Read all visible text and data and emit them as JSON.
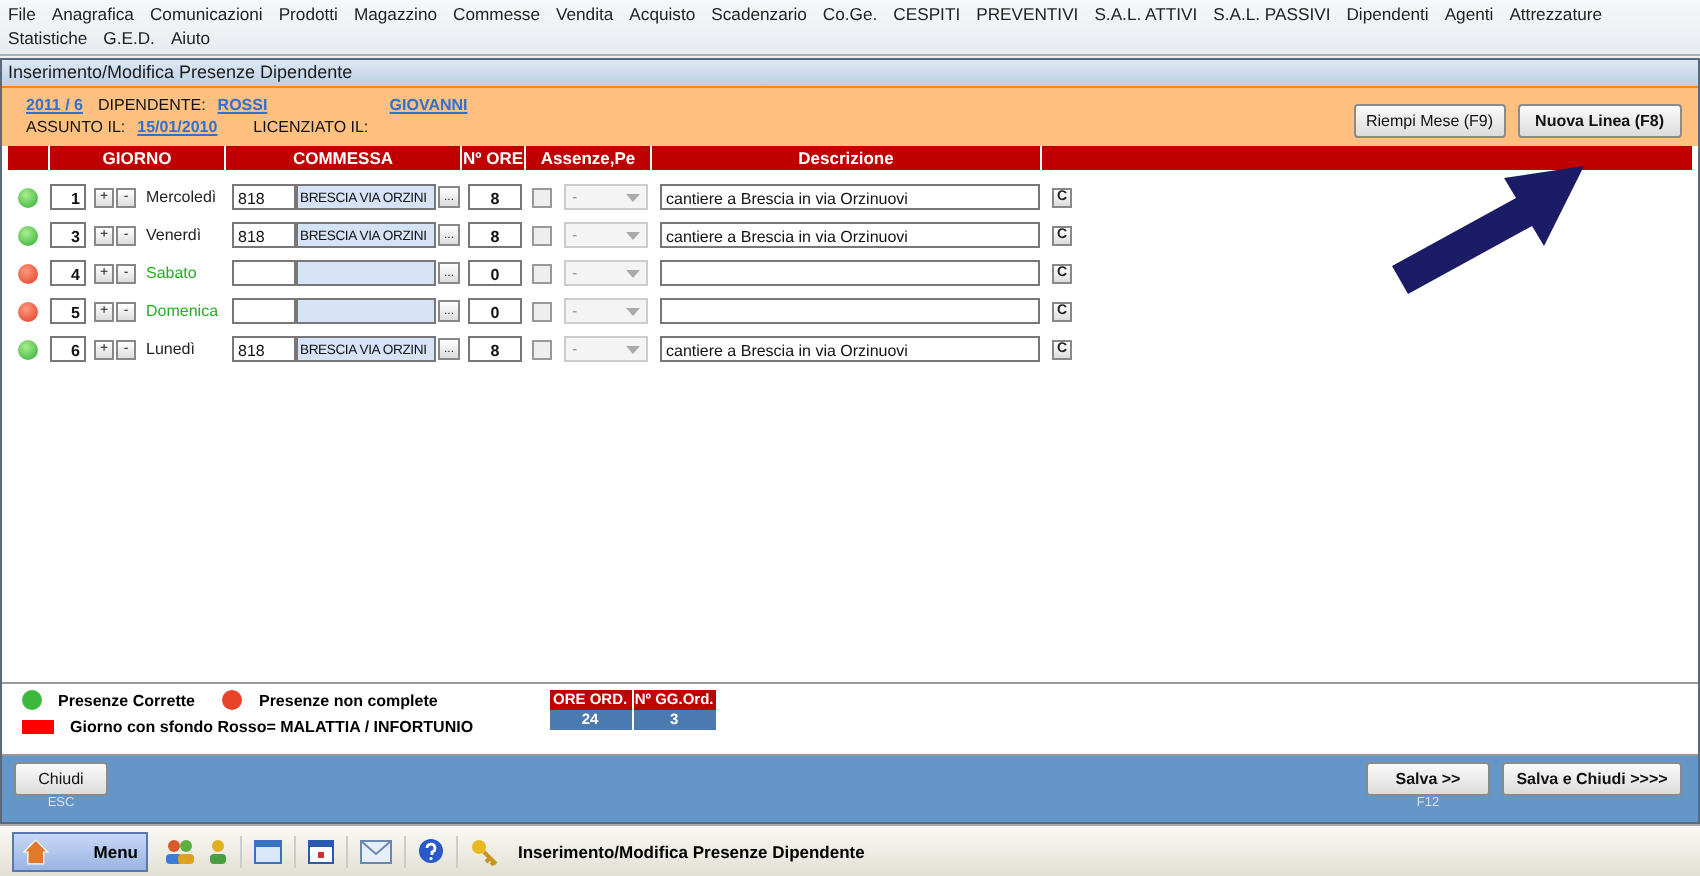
{
  "menu": [
    "File",
    "Anagrafica",
    "Comunicazioni",
    "Prodotti",
    "Magazzino",
    "Commesse",
    "Vendita",
    "Acquisto",
    "Scadenzario",
    "Co.Ge.",
    "CESPITI",
    "PREVENTIVI",
    "S.A.L. ATTIVI",
    "S.A.L. PASSIVI",
    "Dipendenti",
    "Agenti",
    "Attrezzature",
    "Statistiche",
    "G.E.D.",
    "Aiuto"
  ],
  "window": {
    "title": "Inserimento/Modifica Presenze Dipendente"
  },
  "header": {
    "period": "2011 / 6",
    "employee_label": "DIPENDENTE:",
    "surname": "ROSSI",
    "name": "GIOVANNI",
    "hired_label": "ASSUNTO IL:",
    "hired_date": "15/01/2010",
    "fired_label": "LICENZIATO IL:"
  },
  "header_buttons": [
    "Riempi Mese (F9)",
    "Nuova Linea (F8)"
  ],
  "columns": [
    "GIORNO",
    "COMMESSA",
    "Nº ORE",
    "Assenze,Pe",
    "Descrizione"
  ],
  "rows": [
    {
      "complete": true,
      "day": "1",
      "plus": "+",
      "minus": "-",
      "weekday": "Mercoledì",
      "weekend": false,
      "job_code": "818",
      "job_name": "BRESCIA VIA ORZINI",
      "browse": "...",
      "hours": "8",
      "absence": false,
      "absence_type": "-",
      "description": "cantiere a Brescia in via Orzinuovi",
      "clear": "C"
    },
    {
      "complete": true,
      "day": "3",
      "plus": "+",
      "minus": "-",
      "weekday": "Venerdì",
      "weekend": false,
      "job_code": "818",
      "job_name": "BRESCIA VIA ORZINI",
      "browse": "...",
      "hours": "8",
      "absence": false,
      "absence_type": "-",
      "description": "cantiere a Brescia in via Orzinuovi",
      "clear": "C"
    },
    {
      "complete": false,
      "day": "4",
      "plus": "+",
      "minus": "-",
      "weekday": "Sabato",
      "weekend": true,
      "job_code": "",
      "job_name": "",
      "browse": "...",
      "hours": "0",
      "absence": false,
      "absence_type": "-",
      "description": "",
      "clear": "C"
    },
    {
      "complete": false,
      "day": "5",
      "plus": "+",
      "minus": "-",
      "weekday": "Domenica",
      "weekend": true,
      "job_code": "",
      "job_name": "",
      "browse": "...",
      "hours": "0",
      "absence": false,
      "absence_type": "-",
      "description": "",
      "clear": "C"
    },
    {
      "complete": true,
      "day": "6",
      "plus": "+",
      "minus": "-",
      "weekday": "Lunedì",
      "weekend": false,
      "job_code": "818",
      "job_name": "BRESCIA VIA ORZINI",
      "browse": "...",
      "hours": "8",
      "absence": false,
      "absence_type": "-",
      "description": "cantiere a Brescia in via Orzinuovi",
      "clear": "C"
    }
  ],
  "legend": [
    {
      "kind": "dot",
      "color": "#3cb83c",
      "label": "Presenze Corrette"
    },
    {
      "kind": "dot",
      "color": "#e8442a",
      "label": "Presenze non complete"
    },
    {
      "kind": "swatch",
      "color": "#ff0000",
      "label": "Giorno con sfondo Rosso= MALATTIA / INFORTUNIO"
    }
  ],
  "summary": {
    "columns": [
      "ORE ORD.",
      "Nº GG.Ord."
    ],
    "values": [
      "24",
      "3"
    ]
  },
  "footer": {
    "close": {
      "label": "Chiudi",
      "shortcut": "ESC"
    },
    "save": {
      "label": "Salva >>",
      "shortcut": "F12"
    },
    "save_close": {
      "label": "Salva e Chiudi  >>>>"
    }
  },
  "taskbar": {
    "menu": "Menu",
    "title": "Inserimento/Modifica Presenze Dipendente"
  }
}
